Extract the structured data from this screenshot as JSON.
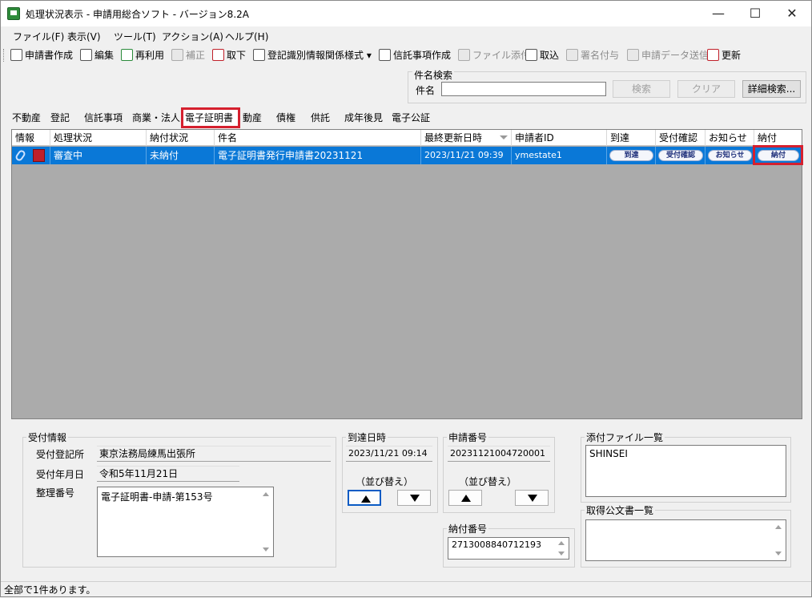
{
  "window": {
    "title": "処理状況表示 - 申請用総合ソフト - バージョン8.2A",
    "minimize": "—",
    "maximize": "☐",
    "close": "✕"
  },
  "menu": [
    "ファイル(F)",
    "表示(V)",
    "ツール(T)",
    "アクション(A)",
    "ヘルプ(H)"
  ],
  "toolbar": [
    {
      "label": "申請書作成",
      "enabled": true
    },
    {
      "label": "編集",
      "enabled": true
    },
    {
      "label": "再利用",
      "enabled": true
    },
    {
      "label": "補正",
      "enabled": false
    },
    {
      "label": "取下",
      "enabled": true
    },
    {
      "label": "登記識別情報関係様式 ▾",
      "enabled": true
    },
    {
      "label": "信託事項作成",
      "enabled": true
    },
    {
      "label": "ファイル添付",
      "enabled": false
    },
    {
      "label": "取込",
      "enabled": true
    },
    {
      "label": "署名付与",
      "enabled": false
    },
    {
      "label": "申請データ送信",
      "enabled": false
    },
    {
      "label": "更新",
      "enabled": true
    }
  ],
  "search": {
    "group_label": "件名検索",
    "field_label": "件名",
    "value": "",
    "search_button": "検索",
    "clear_button": "クリア",
    "detail_button": "詳細検索..."
  },
  "tabs": [
    "不動産",
    "登記",
    "信託事項",
    "商業・法人",
    "電子証明書",
    "動産",
    "債権",
    "供託",
    "成年後見",
    "電子公証"
  ],
  "active_tab": "電子証明書",
  "columns": [
    "情報",
    "処理状況",
    "納付状況",
    "件名",
    "最終更新日時",
    "申請者ID",
    "到達",
    "受付確認",
    "お知らせ",
    "納付"
  ],
  "row": {
    "status": "審査中",
    "payment_status": "未納付",
    "subject": "電子証明書発行申請書20231121",
    "updated": "2023/11/21 09:39",
    "applicant_id": "ymestate1",
    "arrival_btn": "到達",
    "receipt_btn": "受付確認",
    "notice_btn": "お知らせ",
    "payment_btn": "納付"
  },
  "detail": {
    "reception_group": "受付情報",
    "office_label": "受付登記所",
    "office": "東京法務局練馬出張所",
    "date_label": "受付年月日",
    "date": "令和5年11月21日",
    "number_label": "整理番号",
    "number": "電子証明書-申請-第153号",
    "arrival_group": "到達日時",
    "arrival": "2023/11/21 09:14",
    "sort1": "（並び替え）",
    "app_group": "申請番号",
    "app_number": "20231121004720001",
    "sort2": "（並び替え）",
    "pay_group": "納付番号",
    "pay_number": "2713008840712193",
    "attach_group": "添付ファイル一覧",
    "attach_item": "SHINSEI",
    "docs_group": "取得公文書一覧"
  },
  "status_text": "全部で1件あります。",
  "colors": {
    "selection": "#0a78d7",
    "highlight": "#d5202e",
    "grid_bg": "#ababab"
  }
}
